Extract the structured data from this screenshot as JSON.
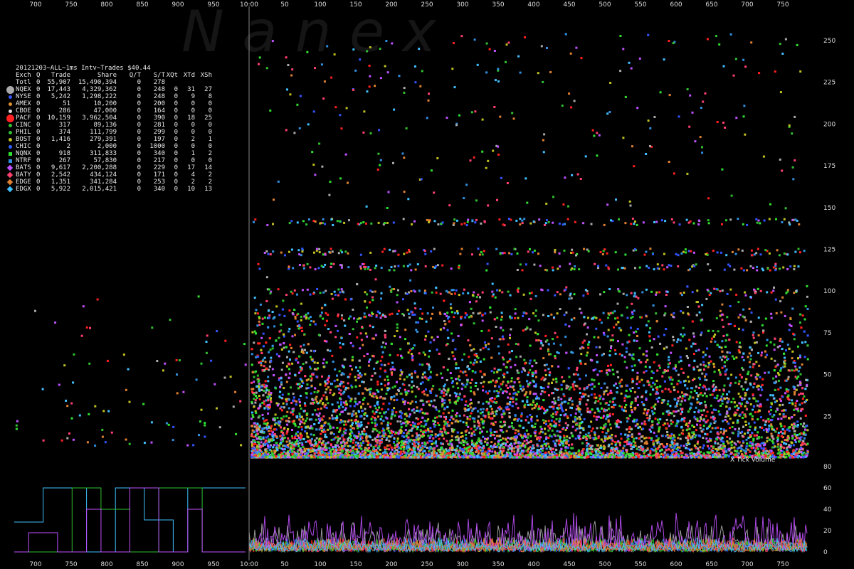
{
  "watermark": "N   a   n   e   x",
  "header_title": "20121203~ALL~1ms Intv~Trades $40.44",
  "volume_label": "X Tick Volume",
  "columns": [
    "Exch",
    "Q",
    "Trade",
    "Share",
    "Q/T",
    "S/T",
    "XQt",
    "XTd",
    "XSh"
  ],
  "stats_rows": [
    {
      "exch": "Totl",
      "q": "0",
      "trade": "55,907",
      "share": "15,490,394",
      "qt": "0",
      "st": "278",
      "xqt": "",
      "xtd": "",
      "xsh": "",
      "marker": "none",
      "color": ""
    },
    {
      "exch": "NQEX",
      "q": "0",
      "trade": "17,443",
      "share": "4,329,362",
      "qt": "0",
      "st": "248",
      "xqt": "0",
      "xtd": "31",
      "xsh": "27",
      "marker": "big-circle",
      "color": "#aaaaaa"
    },
    {
      "exch": "NYSE",
      "q": "0",
      "trade": "5,242",
      "share": "1,298,222",
      "qt": "0",
      "st": "248",
      "xqt": "0",
      "xtd": "9",
      "xsh": "8",
      "marker": "circle",
      "color": "#3355ff"
    },
    {
      "exch": "AMEX",
      "q": "0",
      "trade": "51",
      "share": "10,200",
      "qt": "0",
      "st": "200",
      "xqt": "0",
      "xtd": "0",
      "xsh": "0",
      "marker": "circle",
      "color": "#e09030"
    },
    {
      "exch": "CBOE",
      "q": "0",
      "trade": "286",
      "share": "47,000",
      "qt": "0",
      "st": "164",
      "xqt": "0",
      "xtd": "0",
      "xsh": "0",
      "marker": "circle",
      "color": "#dddddd"
    },
    {
      "exch": "PACF",
      "q": "0",
      "trade": "10,159",
      "share": "3,962,504",
      "qt": "0",
      "st": "390",
      "xqt": "0",
      "xtd": "18",
      "xsh": "25",
      "marker": "big-circle",
      "color": "#ff2020"
    },
    {
      "exch": "CINC",
      "q": "0",
      "trade": "317",
      "share": "89,136",
      "qt": "0",
      "st": "281",
      "xqt": "0",
      "xtd": "0",
      "xsh": "0",
      "marker": "circle",
      "color": "#30c030"
    },
    {
      "exch": "PHIL",
      "q": "0",
      "trade": "374",
      "share": "111,799",
      "qt": "0",
      "st": "299",
      "xqt": "0",
      "xtd": "0",
      "xsh": "0",
      "marker": "circle",
      "color": "#30c030"
    },
    {
      "exch": "BOST",
      "q": "0",
      "trade": "1,416",
      "share": "279,391",
      "qt": "0",
      "st": "197",
      "xqt": "0",
      "xtd": "2",
      "xsh": "1",
      "marker": "circle",
      "color": "#c0c020"
    },
    {
      "exch": "CHIC",
      "q": "0",
      "trade": "2",
      "share": "2,000",
      "qt": "0",
      "st": "1000",
      "xqt": "0",
      "xtd": "0",
      "xsh": "0",
      "marker": "circle",
      "color": "#3060ff"
    },
    {
      "exch": "NQNX",
      "q": "0",
      "trade": "918",
      "share": "311,833",
      "qt": "0",
      "st": "340",
      "xqt": "0",
      "xtd": "1",
      "xsh": "2",
      "marker": "square",
      "color": "#30e030"
    },
    {
      "exch": "NTRF",
      "q": "0",
      "trade": "267",
      "share": "57,830",
      "qt": "0",
      "st": "217",
      "xqt": "0",
      "xtd": "0",
      "xsh": "0",
      "marker": "square",
      "color": "#3090e0"
    },
    {
      "exch": "BATS",
      "q": "0",
      "trade": "9,617",
      "share": "2,200,288",
      "qt": "0",
      "st": "229",
      "xqt": "0",
      "xtd": "17",
      "xsh": "14",
      "marker": "diamond",
      "color": "#c050ff"
    },
    {
      "exch": "BATY",
      "q": "0",
      "trade": "2,542",
      "share": "434,124",
      "qt": "0",
      "st": "171",
      "xqt": "0",
      "xtd": "4",
      "xsh": "2",
      "marker": "diamond",
      "color": "#ff4070"
    },
    {
      "exch": "EDGE",
      "q": "0",
      "trade": "1,351",
      "share": "341,284",
      "qt": "0",
      "st": "253",
      "xqt": "0",
      "xtd": "2",
      "xsh": "2",
      "marker": "diamond",
      "color": "#e08030"
    },
    {
      "exch": "EDGX",
      "q": "0",
      "trade": "5,922",
      "share": "2,015,421",
      "qt": "0",
      "st": "340",
      "xqt": "0",
      "xtd": "10",
      "xsh": "13",
      "marker": "diamond",
      "color": "#40c0ff"
    }
  ],
  "chart_data": {
    "type": "scatter",
    "x_tick_labels": [
      "700",
      "750",
      "800",
      "850",
      "900",
      "950",
      "10:00",
      "50",
      "100",
      "150",
      "200",
      "250",
      "300",
      "350",
      "400",
      "450",
      "500",
      "550",
      "600",
      "650",
      "700",
      "750"
    ],
    "y_tick_labels": [
      "25",
      "50",
      "75",
      "100",
      "125",
      "150",
      "175",
      "200",
      "225",
      "250"
    ],
    "y_range": [
      0,
      260
    ],
    "volume_tick_labels": [
      "0",
      "20",
      "40",
      "60",
      "80"
    ],
    "volume_range": [
      0,
      80
    ],
    "grid": false,
    "series_colors": [
      "#aaaaaa",
      "#3355ff",
      "#ff2020",
      "#30c030",
      "#c0c020",
      "#30e030",
      "#3090e0",
      "#c050ff",
      "#ff4070",
      "#e08030",
      "#40c0ff"
    ]
  }
}
